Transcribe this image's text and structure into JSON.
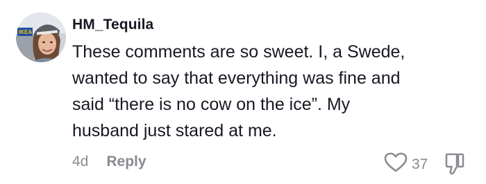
{
  "comment": {
    "username": "HM_Tequila",
    "lines": [
      "These comments are so sweet. I, a Swede,",
      "wanted to say that everything was fine and",
      "said “there is no cow on the ice”. My",
      "husband just stared at me."
    ],
    "timestamp": "4d",
    "reply_label": "Reply",
    "like_count": "37",
    "avatar_sign_text": "IKEA"
  },
  "icons": {
    "like": "heart-outline-icon",
    "dislike": "thumbs-down-outline-icon"
  },
  "colors": {
    "text_primary": "#161823",
    "text_secondary": "#8a8b91",
    "background": "#ffffff"
  }
}
